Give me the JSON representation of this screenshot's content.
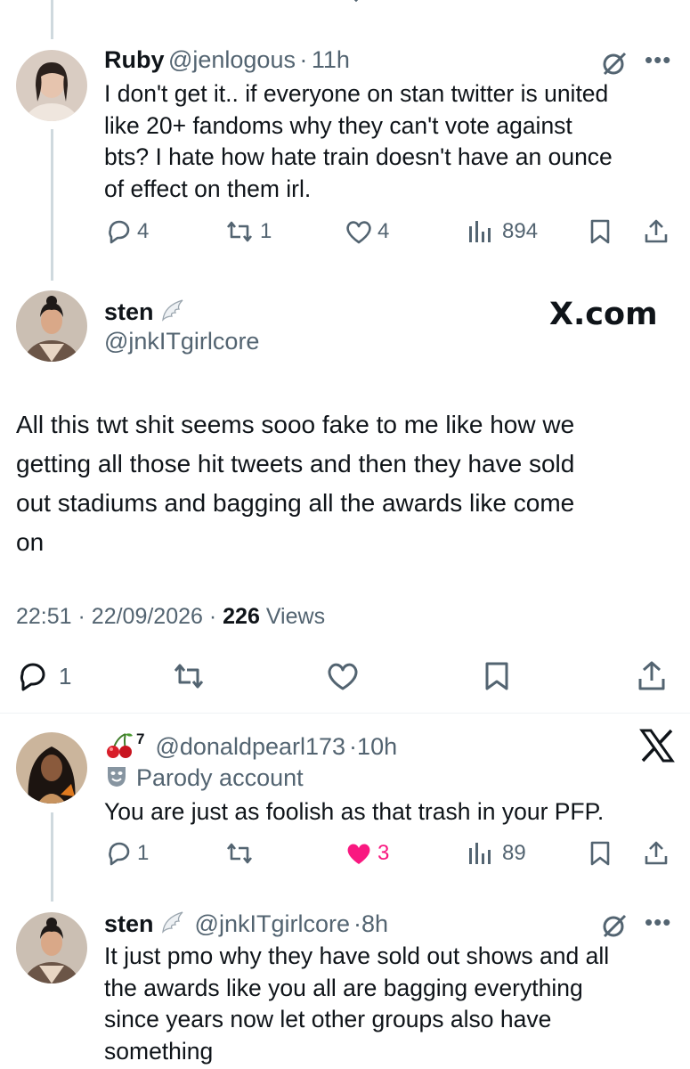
{
  "top_reply": {
    "display_name": "Ruby",
    "handle": "@jenlogous",
    "time": "11h",
    "text_lines": [
      "I don't get it.. if everyone on stan twitter is united",
      "like 20+ fandoms why they can't vote against",
      "bts? I hate how hate train doesn't have an ounce",
      "of effect on them irl."
    ],
    "replies": "4",
    "reposts": "1",
    "likes": "4",
    "views": "894"
  },
  "main_tweet": {
    "display_name": "sten",
    "handle": "@jnkITgirlcore",
    "watermark": "X.com",
    "text_lines": [
      "All this twt shit seems sooo fake to me like how we",
      "getting all those hit tweets and then they have sold",
      "out stadiums and bagging all the awards like come",
      "on"
    ],
    "time": "22:51",
    "date": "22/09/2026",
    "views_count": "226",
    "views_label": "Views",
    "replies": "1"
  },
  "reply_one": {
    "display_name_suffix": "7",
    "handle": "@donaldpearl173",
    "time": "10h",
    "parody_label": "Parody account",
    "text": "You are just as foolish as that trash in your PFP.",
    "replies": "1",
    "likes": "3",
    "views": "89",
    "like_color": "#f91880"
  },
  "reply_two": {
    "display_name": "sten",
    "handle": "@jnkITgirlcore",
    "time": "8h",
    "text_lines": [
      "It just pmo why they have sold out shows and all",
      "the awards like you all are bagging everything",
      "since years now let other groups also have",
      "something"
    ]
  },
  "separator": "·",
  "colors": {
    "text": "#0f1419",
    "muted": "#536471",
    "line": "#cfd9de",
    "like": "#f91880"
  }
}
